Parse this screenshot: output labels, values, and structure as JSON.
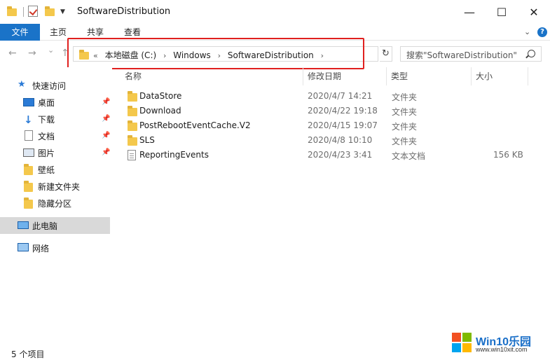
{
  "window": {
    "title": "SoftwareDistribution",
    "minimize": "—",
    "maximize": "☐",
    "close": "✕"
  },
  "ribbon": {
    "tabs": [
      "文件",
      "主页",
      "共享",
      "查看"
    ]
  },
  "nav": {
    "back": "←",
    "forward": "→",
    "recent": "⌄",
    "up": "↑",
    "address_prefix": "«",
    "breadcrumbs": [
      "本地磁盘 (C:)",
      "Windows",
      "SoftwareDistribution"
    ],
    "crumb_sep": "›",
    "search_placeholder": "搜索\"SoftwareDistribution\""
  },
  "sidebar": {
    "items": [
      {
        "label": "快速访问",
        "icon": "star-icon",
        "pinned": false
      },
      {
        "label": "桌面",
        "icon": "desktop-icon",
        "pinned": true
      },
      {
        "label": "下载",
        "icon": "download-icon",
        "pinned": true
      },
      {
        "label": "文档",
        "icon": "document-icon",
        "pinned": true
      },
      {
        "label": "图片",
        "icon": "picture-icon",
        "pinned": true
      },
      {
        "label": "壁纸",
        "icon": "folder-icon",
        "pinned": false
      },
      {
        "label": "新建文件夹",
        "icon": "folder-icon",
        "pinned": false
      },
      {
        "label": "隐藏分区",
        "icon": "folder-icon",
        "pinned": false
      },
      {
        "label": "此电脑",
        "icon": "computer-icon",
        "pinned": false,
        "selected": true
      },
      {
        "label": "网络",
        "icon": "network-icon",
        "pinned": false
      }
    ]
  },
  "columns": {
    "name": "名称",
    "modified": "修改日期",
    "type": "类型",
    "size": "大小"
  },
  "files": [
    {
      "name": "DataStore",
      "modified": "2020/4/7 14:21",
      "type": "文件夹",
      "size": "",
      "kind": "folder"
    },
    {
      "name": "Download",
      "modified": "2020/4/22 19:18",
      "type": "文件夹",
      "size": "",
      "kind": "folder"
    },
    {
      "name": "PostRebootEventCache.V2",
      "modified": "2020/4/15 19:07",
      "type": "文件夹",
      "size": "",
      "kind": "folder"
    },
    {
      "name": "SLS",
      "modified": "2020/4/8 10:10",
      "type": "文件夹",
      "size": "",
      "kind": "folder"
    },
    {
      "name": "ReportingEvents",
      "modified": "2020/4/23 3:41",
      "type": "文本文档",
      "size": "156 KB",
      "kind": "file"
    }
  ],
  "status": {
    "count": "5 个项目"
  },
  "watermark": {
    "brand_win": "Win",
    "brand_10": "10",
    "brand_le": "乐园",
    "url": "www.win10xit.com"
  },
  "colors": {
    "accent": "#1a73c8",
    "folder": "#f4c84c",
    "highlight": "#e0201f",
    "selected": "#d9d9d9"
  }
}
